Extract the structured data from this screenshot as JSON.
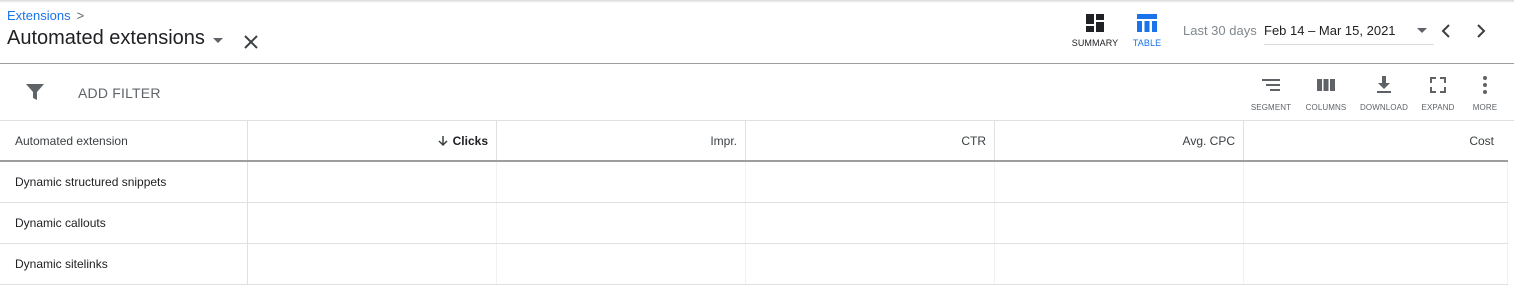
{
  "header": {
    "breadcrumb": "Extensions",
    "breadcrumb_separator": ">",
    "title": "Automated extensions",
    "views": [
      {
        "label": "SUMMARY",
        "icon": "summary-dashboard-icon",
        "active": false
      },
      {
        "label": "TABLE",
        "icon": "table-icon",
        "active": true
      }
    ],
    "date_range_label": "Last 30 days",
    "date_range_value": "Feb 14 – Mar 15, 2021"
  },
  "toolbar": {
    "add_filter": "ADD FILTER",
    "tools": [
      {
        "label": "SEGMENT",
        "icon": "segment-icon"
      },
      {
        "label": "COLUMNS",
        "icon": "columns-icon"
      },
      {
        "label": "DOWNLOAD",
        "icon": "download-icon"
      },
      {
        "label": "EXPAND",
        "icon": "expand-icon"
      },
      {
        "label": "MORE",
        "icon": "more-vert-icon"
      }
    ]
  },
  "table": {
    "columns": [
      "Automated extension",
      "Clicks",
      "Impr.",
      "CTR",
      "Avg. CPC",
      "Cost"
    ],
    "sorted_column": "Clicks",
    "rows": [
      {
        "name": "Dynamic structured snippets"
      },
      {
        "name": "Dynamic callouts"
      },
      {
        "name": "Dynamic sitelinks"
      }
    ]
  },
  "colors": {
    "accent": "#1a73e8",
    "text": "#202124",
    "muted": "#5f6368"
  }
}
